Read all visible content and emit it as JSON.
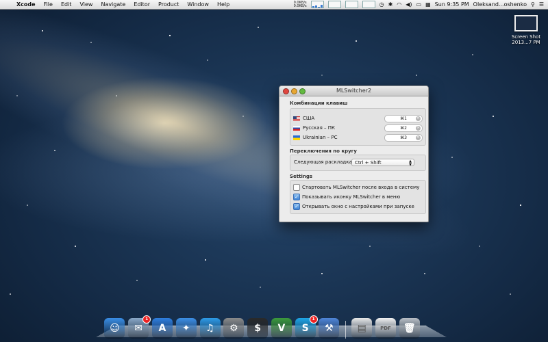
{
  "menubar": {
    "apple": "",
    "app_name": "Xcode",
    "menus": [
      "File",
      "Edit",
      "View",
      "Navigate",
      "Editor",
      "Product",
      "Window",
      "Help"
    ],
    "net_up": "0.0KB/s",
    "net_down": "0.0KB/s",
    "cpu_levels": [
      0.2,
      0.35,
      0.15,
      0.5
    ],
    "clock": "Sun 9:35 PM",
    "user": "Oleksand...oshenko"
  },
  "desktop": {
    "icon_label_line1": "Screen Shot",
    "icon_label_line2": "2013...7 PM"
  },
  "window": {
    "title": "MLSwitcher2",
    "shortcuts_section": "Комбинации клавиш",
    "languages": [
      {
        "name": "США",
        "flag": "us",
        "shortcut": "⌘1"
      },
      {
        "name": "Русская – ПК",
        "flag": "ru",
        "shortcut": "⌘2"
      },
      {
        "name": "Ukrainian – PC",
        "flag": "ua",
        "shortcut": "⌘3"
      }
    ],
    "cycle_section": "Переключения по кругу",
    "next_layout_label": "Следующая раскладка",
    "next_layout_value": "Ctrl + Shift",
    "settings_section": "Settings",
    "options": [
      {
        "label": "Стартовать MLSwitcher после входа в систему",
        "checked": false
      },
      {
        "label": "Показывать иконку MLSwitcher в меню",
        "checked": true
      },
      {
        "label": "Открывать окно с настройками при запуске",
        "checked": true
      }
    ]
  },
  "dock": {
    "apps": [
      {
        "name": "finder-icon",
        "color": "#3a8ee6",
        "glyph": "☺",
        "badge": ""
      },
      {
        "name": "mail-stamp-icon",
        "color": "#8aa8c8",
        "glyph": "✉",
        "badge": "1"
      },
      {
        "name": "app-store-icon",
        "color": "#2f7fe0",
        "glyph": "A",
        "badge": ""
      },
      {
        "name": "safari-icon",
        "color": "#3d8fe6",
        "glyph": "✦",
        "badge": ""
      },
      {
        "name": "itunes-icon",
        "color": "#2e9be8",
        "glyph": "♫",
        "badge": ""
      },
      {
        "name": "system-preferences-icon",
        "color": "#8b8b8b",
        "glyph": "⚙",
        "badge": ""
      },
      {
        "name": "terminal-icon",
        "color": "#2a2a2a",
        "glyph": "$",
        "badge": ""
      },
      {
        "name": "vim-icon",
        "color": "#3c9a3c",
        "glyph": "V",
        "badge": ""
      },
      {
        "name": "skype-icon",
        "color": "#1fa6e8",
        "glyph": "S",
        "badge": "1"
      },
      {
        "name": "xcode-icon",
        "color": "#4f86d9",
        "glyph": "⚒",
        "badge": ""
      }
    ],
    "docs": [
      {
        "name": "document-icon",
        "color": "#e8e8e8",
        "glyph": "▤",
        "badge": ""
      },
      {
        "name": "pdf-icon",
        "color": "#f2f2f2",
        "glyph": "PDF",
        "badge": ""
      },
      {
        "name": "trash-icon",
        "color": "#b9bfc6",
        "glyph": "🗑",
        "badge": ""
      }
    ]
  }
}
